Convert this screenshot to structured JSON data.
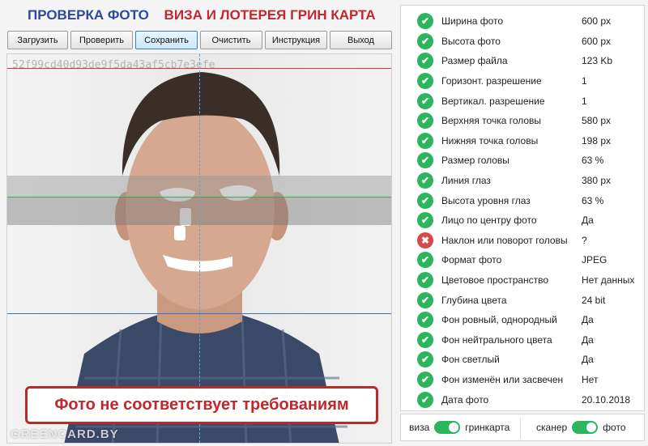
{
  "title": {
    "part1": "ПРОВЕРКА ФОТО",
    "part2": "ВИЗА И ЛОТЕРЕЯ ГРИН КАРТА"
  },
  "toolbar": {
    "load": "Загрузить",
    "check": "Проверить",
    "save": "Сохранить",
    "clear": "Очистить",
    "instruction": "Инструкция",
    "exit": "Выход"
  },
  "photo": {
    "hash": "52f99cd40d93de9f5da43af5cb7e3efe",
    "verdict": "Фото не соответствует требованиям",
    "watermark": "GREENCARD.BY"
  },
  "checks": [
    {
      "label": "Ширина фото",
      "value": "600 px",
      "ok": true
    },
    {
      "label": "Высота фото",
      "value": "600 px",
      "ok": true
    },
    {
      "label": "Размер файла",
      "value": "123 Kb",
      "ok": true
    },
    {
      "label": "Горизонт. разрешение",
      "value": "1",
      "ok": true
    },
    {
      "label": "Вертикал. разрешение",
      "value": "1",
      "ok": true
    },
    {
      "label": "Верхняя точка головы",
      "value": "580 px",
      "ok": true
    },
    {
      "label": "Нижняя точка головы",
      "value": "198 px",
      "ok": true
    },
    {
      "label": "Размер головы",
      "value": "63 %",
      "ok": true
    },
    {
      "label": "Линия глаз",
      "value": "380 px",
      "ok": true
    },
    {
      "label": "Высота уровня глаз",
      "value": "63 %",
      "ok": true
    },
    {
      "label": "Лицо по центру фото",
      "value": "Да",
      "ok": true
    },
    {
      "label": "Наклон или поворот головы",
      "value": "?",
      "ok": false
    },
    {
      "label": "Формат фото",
      "value": "JPEG",
      "ok": true
    },
    {
      "label": "Цветовое пространство",
      "value": "Нет данных",
      "ok": true
    },
    {
      "label": "Глубина цвета",
      "value": "24 bit",
      "ok": true
    },
    {
      "label": "Фон ровный, однородный",
      "value": "Да",
      "ok": true
    },
    {
      "label": "Фон нейтрального цвета",
      "value": "Да",
      "ok": true
    },
    {
      "label": "Фон светлый",
      "value": "Да",
      "ok": true
    },
    {
      "label": "Фон изменён или засвечен",
      "value": "Нет",
      "ok": true
    },
    {
      "label": "Дата фото",
      "value": "20.10.2018",
      "ok": true
    }
  ],
  "toggles": {
    "left_off": "виза",
    "left_on": "гринкарта",
    "right_off": "сканер",
    "right_on": "фото"
  },
  "icons": {
    "ok": "check-circle-icon",
    "bad": "cross-circle-icon"
  },
  "colors": {
    "ok": "#2db55d",
    "bad": "#d9474c",
    "title_blue": "#2a4a9c",
    "title_red": "#c0282d"
  }
}
